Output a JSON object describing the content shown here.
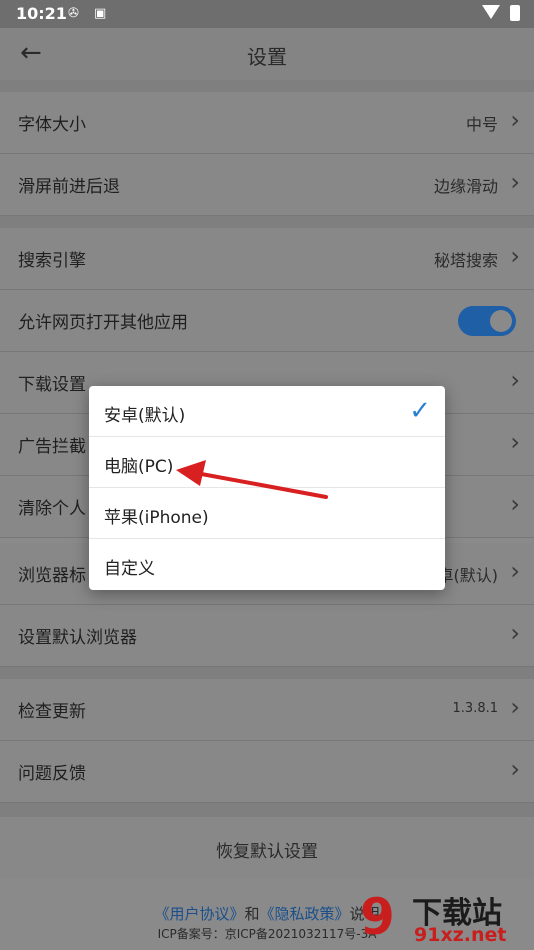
{
  "status_bar": {
    "time": "10:21",
    "icons": [
      "sync-icon",
      "a-icon",
      "wifi-icon",
      "battery-icon"
    ]
  },
  "header": {
    "title": "设置",
    "back_icon": "arrow-left-icon"
  },
  "settings": {
    "font_size": {
      "label": "字体大小",
      "value": "中号"
    },
    "swipe_nav": {
      "label": "滑屏前进后退",
      "value": "边缘滑动"
    },
    "search_engine": {
      "label": "搜索引擎",
      "value": "秘塔搜索"
    },
    "allow_open_apps": {
      "label": "允许网页打开其他应用",
      "enabled": true
    },
    "download": {
      "label": "下载设置"
    },
    "ad_block": {
      "label": "广告拦截"
    },
    "clear_personal": {
      "label": "清除个人"
    },
    "browser_ua": {
      "label": "浏览器标",
      "value": "卓(默认)"
    },
    "set_default_browser": {
      "label": "设置默认浏览器"
    },
    "check_update": {
      "label": "检查更新",
      "value": "1.3.8.1"
    },
    "feedback": {
      "label": "问题反馈"
    },
    "restore_default": {
      "label": "恢复默认设置"
    }
  },
  "dropdown": {
    "options": [
      {
        "label": "安卓(默认)",
        "selected": true
      },
      {
        "label": "电脑(PC)",
        "selected": false
      },
      {
        "label": "苹果(iPhone)",
        "selected": false
      },
      {
        "label": "自定义",
        "selected": false
      }
    ]
  },
  "footer": {
    "user_agreement": "《用户协议》",
    "and": "和",
    "privacy_policy": "《隐私政策》",
    "explain": "说明",
    "icp": "ICP备案号：京ICP备2021032117号-3A"
  },
  "watermark": {
    "mark": "9",
    "cn": "下载站",
    "domain": "91xz.net"
  },
  "colors": {
    "accent": "#2a7fd4",
    "toggle_on": "#1f5fa6",
    "arrow": "#d92020",
    "link": "#1b4f8c"
  }
}
